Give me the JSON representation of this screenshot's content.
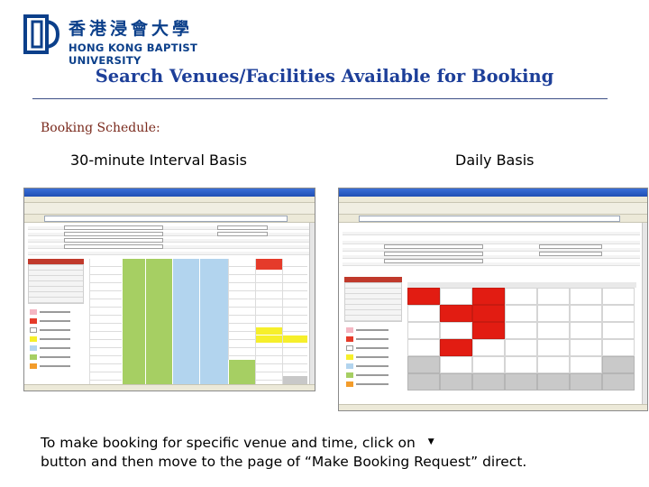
{
  "header": {
    "logo_zh": "香港浸會大學",
    "logo_en": "HONG KONG BAPTIST UNIVERSITY",
    "title": "Search Venues/Facilities Available for Booking"
  },
  "section": {
    "label": "Booking Schedule:"
  },
  "captions": {
    "left": "30-minute Interval Basis",
    "right": "Daily Basis"
  },
  "instructions": {
    "line1": "To make booking for specific venue and time, click on",
    "dropdown_glyph": "▼",
    "line2": "button and then move to the page of “Make Booking Request” direct."
  },
  "colors": {
    "title": "#1d3f99",
    "section_label": "#7a2a1d",
    "logo": "#0b3f8a",
    "available_green": "#a6cf63",
    "available_blue": "#b2d4ee",
    "booked_red": "#e53b2a",
    "pending_yellow": "#f6ef2b"
  },
  "icons": {
    "dropdown": "chevron-down-icon",
    "logo": "hkbu-logo-icon"
  }
}
